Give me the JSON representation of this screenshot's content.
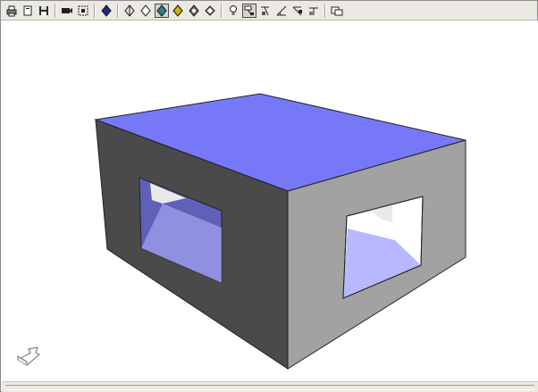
{
  "toolbar": {
    "buttons": [
      {
        "name": "print-icon",
        "active": false
      },
      {
        "name": "copy-icon",
        "active": false
      },
      {
        "name": "save-icon",
        "active": false
      },
      {
        "sep": true
      },
      {
        "name": "camera-icon",
        "active": false
      },
      {
        "name": "fit-view-icon",
        "active": false
      },
      {
        "sep": true
      },
      {
        "name": "shaded-mode-icon",
        "active": false
      },
      {
        "sep": true
      },
      {
        "name": "wireframe-mode-icon",
        "active": false
      },
      {
        "name": "hidden-line-icon",
        "active": false
      },
      {
        "name": "shaded-edges-icon",
        "active": true
      },
      {
        "name": "material-icon",
        "active": false
      },
      {
        "name": "explode-icon",
        "active": false
      },
      {
        "name": "perspective-icon",
        "active": false
      },
      {
        "sep": true
      },
      {
        "name": "light-icon",
        "active": false
      },
      {
        "name": "annotation-icon",
        "active": true
      },
      {
        "name": "dimension-icon",
        "active": false
      },
      {
        "name": "measure-angle-icon",
        "active": false
      },
      {
        "name": "measure-distance-icon",
        "active": false
      },
      {
        "name": "section-icon",
        "active": false
      },
      {
        "sep": true
      },
      {
        "name": "window-icon",
        "active": false
      }
    ]
  },
  "scene": {
    "top_color": "#7778f8",
    "front_color": "#4a4a4a",
    "right_color": "#a2a2a2",
    "window_inner_blue": "#6060b8",
    "window_floor_blue": "#b7b8ff",
    "window_inner_gray": "#e9e9e9"
  }
}
